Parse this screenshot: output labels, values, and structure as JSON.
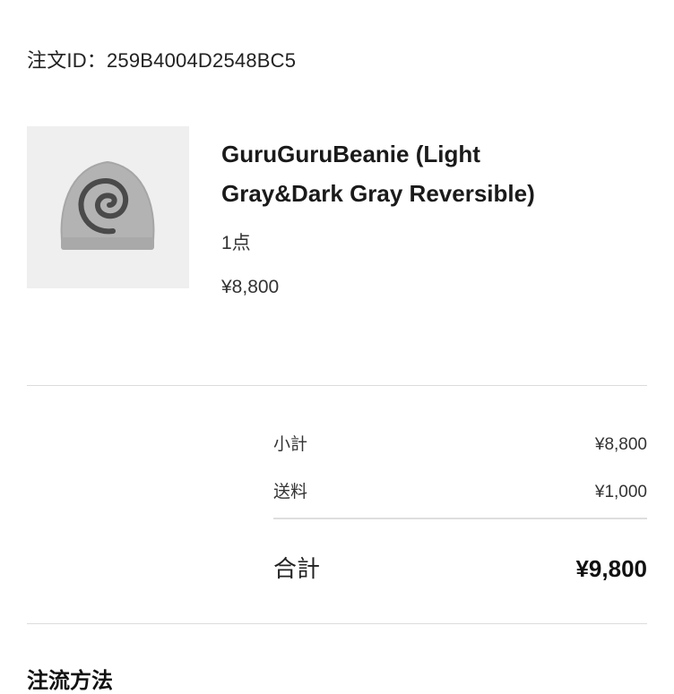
{
  "order": {
    "id_label": "注文ID：259B4004D2548BC5"
  },
  "product": {
    "image_icon": "gray-swirl-beanie",
    "title_line1": "GuruGuruBeanie (Light",
    "title_line2": "Gray&Dark Gray Reversible)",
    "quantity": "1点",
    "price": "¥8,800"
  },
  "summary": {
    "subtotal_label": "小計",
    "subtotal_value": "¥8,800",
    "shipping_label": "送料",
    "shipping_value": "¥1,000",
    "total_label": "合計",
    "total_value": "¥9,800"
  },
  "next_section": {
    "heading": "注流方法"
  }
}
